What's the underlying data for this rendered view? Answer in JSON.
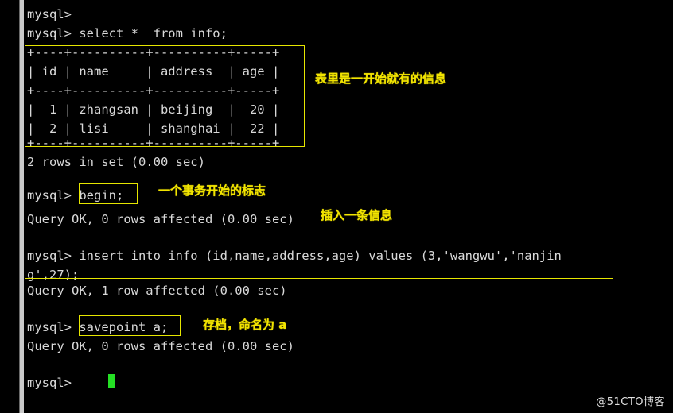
{
  "window": {
    "app": "mysql-client-terminal",
    "background_color": "#000000",
    "text_color": "#d9d9d9",
    "annotation_color": "#f2e400",
    "cursor_color": "#25e025"
  },
  "terminal": {
    "lines": [
      {
        "text": "mysql>"
      },
      {
        "text": "mysql> select *  from info;"
      },
      {
        "text": "+----+----------+----------+-----+"
      },
      {
        "text": "| id | name     | address  | age |"
      },
      {
        "text": "+----+----------+----------+-----+"
      },
      {
        "text": "|  1 | zhangsan | beijing  |  20 |"
      },
      {
        "text": "|  2 | lisi     | shanghai |  22 |"
      },
      {
        "text": "+----+----------+----------+-----+"
      },
      {
        "text": "2 rows in set (0.00 sec)"
      },
      {
        "text": ""
      },
      {
        "text": "mysql> begin;"
      },
      {
        "text": "Query OK, 0 rows affected (0.00 sec)"
      },
      {
        "text": ""
      },
      {
        "text": ""
      },
      {
        "text": "mysql> insert into info (id,name,address,age) values (3,'wangwu','nanjin"
      },
      {
        "text": "g',27);"
      },
      {
        "text": "Query OK, 1 row affected (0.00 sec)"
      },
      {
        "text": ""
      },
      {
        "text": ""
      },
      {
        "text": "mysql> savepoint a;"
      },
      {
        "text": "Query OK, 0 rows affected (0.00 sec)"
      },
      {
        "text": ""
      },
      {
        "text": ""
      },
      {
        "text": "mysql>"
      }
    ]
  },
  "result_table": {
    "type": "table",
    "columns": [
      "id",
      "name",
      "address",
      "age"
    ],
    "rows": [
      [
        "1",
        "zhangsan",
        "beijing",
        "20"
      ],
      [
        "2",
        "lisi",
        "shanghai",
        "22"
      ]
    ],
    "footer": "2 rows in set (0.00 sec)"
  },
  "annotations": [
    {
      "id": "anno-table-info",
      "text": "表里是一开始就有的信息"
    },
    {
      "id": "anno-begin",
      "text": "一个事务开始的标志"
    },
    {
      "id": "anno-insert",
      "text": "插入一条信息"
    },
    {
      "id": "anno-savepoint",
      "text": "存档，命名为 a"
    }
  ],
  "highlight_boxes": [
    {
      "id": "box-result-table",
      "target": "select-result-table"
    },
    {
      "id": "box-begin",
      "target": "begin-command"
    },
    {
      "id": "box-insert",
      "target": "insert-command"
    },
    {
      "id": "box-savepoint",
      "target": "savepoint-command"
    }
  ],
  "prompt": {
    "symbol": "mysql>",
    "cursor": "block"
  },
  "watermark": {
    "text": "@51CTO博客"
  }
}
